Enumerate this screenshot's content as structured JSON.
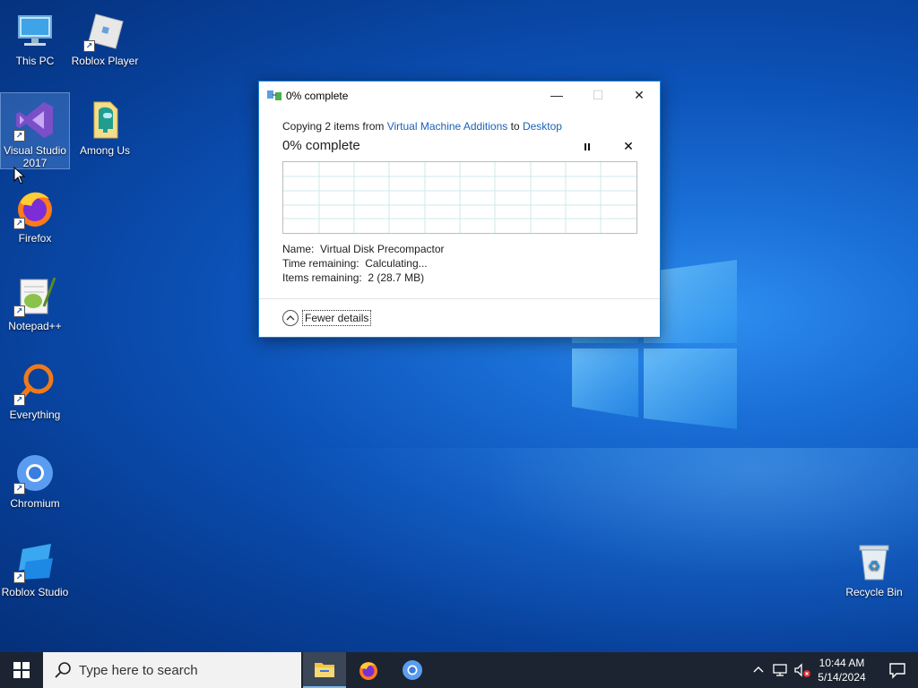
{
  "desktop": {
    "icons": [
      {
        "label": "This PC",
        "icon": "computer-icon"
      },
      {
        "label": "Roblox Player",
        "icon": "roblox-player-icon"
      },
      {
        "label": "Visual Studio 2017",
        "icon": "visual-studio-icon"
      },
      {
        "label": "Among Us",
        "icon": "folder-icon"
      },
      {
        "label": "Firefox",
        "icon": "firefox-icon"
      },
      {
        "label": "Notepad++",
        "icon": "notepadpp-icon"
      },
      {
        "label": "Everything",
        "icon": "everything-search-icon"
      },
      {
        "label": "Chromium",
        "icon": "chromium-icon"
      },
      {
        "label": "Roblox Studio",
        "icon": "roblox-studio-icon"
      },
      {
        "label": "Recycle Bin",
        "icon": "recycle-bin-icon"
      }
    ],
    "selected_icon": "Visual Studio 2017"
  },
  "dialog": {
    "title": "0% complete",
    "summary_prefix": "Copying 2 items from ",
    "source": "Virtual Machine Additions",
    "summary_middle": " to ",
    "destination": "Desktop",
    "progress_heading": "0% complete",
    "progress_percent": 0,
    "name_label": "Name:",
    "name_value": "Virtual Disk Precompactor",
    "time_label": "Time remaining:",
    "time_value": "Calculating...",
    "items_label": "Items remaining:",
    "items_value": "2 (28.7 MB)",
    "fewer_details_label": "Fewer details",
    "close_glyph": "✕",
    "cancel_glyph": "✕",
    "minimize_glyph": "—",
    "maximize_glyph": "☐"
  },
  "taskbar": {
    "search_placeholder": "Type here to search",
    "apps": [
      "File Explorer",
      "Firefox",
      "Chromium"
    ],
    "clock_time": "10:44 AM",
    "clock_date": "5/14/2024"
  },
  "colors": {
    "accent": "#1a62b8",
    "taskbar": "#1c2431",
    "desktop": "#0c52b8"
  }
}
